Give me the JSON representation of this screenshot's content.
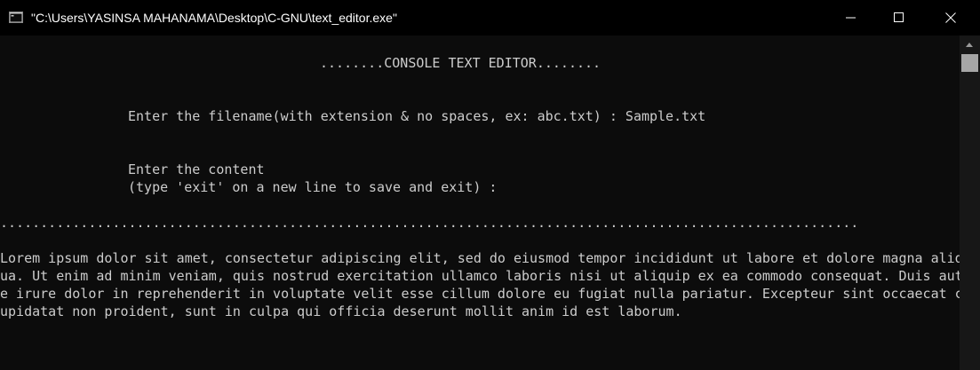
{
  "window": {
    "title": "\"C:\\Users\\YASINSA MAHANAMA\\Desktop\\C-GNU\\text_editor.exe\"",
    "controls": {
      "minimize": "minimize-icon",
      "maximize": "maximize-icon",
      "close": "close-icon"
    }
  },
  "console": {
    "heading": "........CONSOLE TEXT EDITOR........",
    "filename_prompt": "Enter the filename(with extension & no spaces, ex: abc.txt) : Sample.txt",
    "content_prompt_1": "Enter the content",
    "content_prompt_2": "(type 'exit' on a new line to save and exit) :",
    "separator": "...........................................................................................................",
    "body_lines": [
      "Lorem ipsum dolor sit amet, consectetur adipiscing elit, sed do eiusmod tempor incididunt ut labore et dolore magna aliq",
      "ua. Ut enim ad minim veniam, quis nostrud exercitation ullamco laboris nisi ut aliquip ex ea commodo consequat. Duis aut",
      "e irure dolor in reprehenderit in voluptate velit esse cillum dolore eu fugiat nulla pariatur. Excepteur sint occaecat c",
      "upidatat non proident, sunt in culpa qui officia deserunt mollit anim id est laborum."
    ]
  },
  "colors": {
    "background": "#0c0c0c",
    "titlebar": "#000000",
    "text": "#cccccc"
  }
}
